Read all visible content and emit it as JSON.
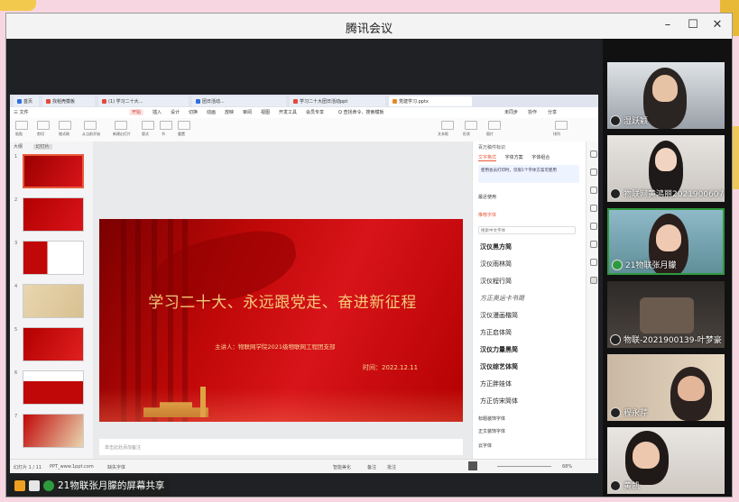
{
  "window": {
    "title": "腾讯会议",
    "controls": [
      "minimize-icon",
      "maximize-icon",
      "close-icon"
    ]
  },
  "wps": {
    "tabs": [
      {
        "label": "首页",
        "color": "#2f6fe0"
      },
      {
        "label": "找稻壳模板",
        "color": "#e24a3b"
      },
      {
        "label": "(1) 学习二十大...",
        "color": "#e24a3b"
      },
      {
        "label": "团日活动...",
        "color": "#2f6fe0"
      },
      {
        "label": "学习二十大团日活动ppt",
        "color": "#e24a3b"
      },
      {
        "label": "党建学习.pptx",
        "color": "#e8892c"
      }
    ],
    "menu": [
      "三 文件",
      "开始",
      "插入",
      "设计",
      "切换",
      "动画",
      "放映",
      "审阅",
      "视图",
      "开发工具",
      "会员专享",
      "Q 查找命令、搜索模板"
    ],
    "menu_right": [
      "未同步",
      "协作",
      "分享"
    ],
    "toolbar": [
      "粘贴",
      "剪切",
      "格式刷",
      "从当前开始",
      "新建幻灯片",
      "版式",
      "节",
      "重置",
      "文本框",
      "形状",
      "图片",
      "排列"
    ],
    "left_panel_tabs": [
      "大纲",
      "幻灯片"
    ],
    "slide_numbers": [
      "1",
      "2",
      "3",
      "4",
      "5",
      "6",
      "7"
    ],
    "slide": {
      "title": "学习二十大、永远跟党走、奋进新征程",
      "subtitle": "主讲人：物联网学院2021级物联网工程团支部",
      "date": "时间：2022.12.11"
    },
    "right_panel": {
      "header": "百万稿件标识",
      "tabs": [
        "文字格式",
        "字体方案",
        "字体组合"
      ],
      "notice": "使用会员打印时，仅限1个字体方案可使用",
      "sections": [
        "最近使用",
        "推荐字体",
        "标题装饰字体",
        "正文装饰字体",
        "云字体"
      ],
      "search_placeholder": "搜索中文字体",
      "fonts": [
        "汉仪黑方简",
        "汉仪雨林简",
        "汉仪程行简",
        "方正奥运卡书简",
        "汉仪漫画楷简",
        "方正启体简",
        "汉仪力量黑简",
        "汉仪综艺体简",
        "方正胖娃体",
        "方正仿宋简体"
      ]
    },
    "status": {
      "slide_count": "幻灯片 1 / 11",
      "theme": "PPT_www.1ppt.com",
      "missing_font": "缺失字体",
      "notes_placeholder": "单击此处添加备注",
      "smart_beautify": "智能美化",
      "notes": "备注",
      "comments": "批注",
      "zoom": "68%"
    }
  },
  "participants": [
    {
      "name": "湿跃颖",
      "mic": "off"
    },
    {
      "name": "物联网黄鸿丽2021900607",
      "mic": "off"
    },
    {
      "name": "21物联张月朦",
      "mic": "on"
    },
    {
      "name": "物联-2021900139-叶梦豪",
      "mic": "off"
    },
    {
      "name": "程永芹",
      "mic": "off"
    },
    {
      "name": "黄凯",
      "mic": "off"
    }
  ],
  "share_banner": {
    "label": "21物联张月朦的屏幕共享"
  },
  "colors": {
    "accent": "#e85a3c",
    "mic_active": "#2e9a3e",
    "slide_red": "#d8141a",
    "title_gold": "#f3c97a"
  }
}
